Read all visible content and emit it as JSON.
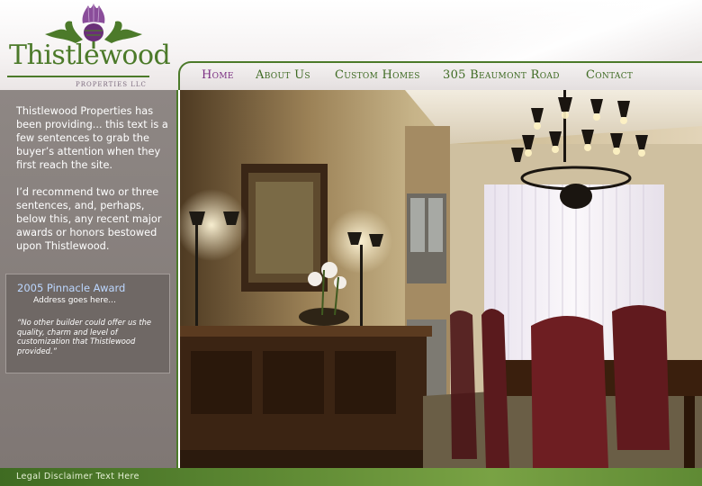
{
  "brand": {
    "name": "Thistlewood",
    "subtitle": "PROPERTIES LLC",
    "thistle_color": "#7a3c88",
    "leaf_color": "#4c7a2a"
  },
  "nav": {
    "items": [
      {
        "label": "Home",
        "active": true
      },
      {
        "label": "About Us",
        "active": false
      },
      {
        "label": "Custom Homes",
        "active": false
      },
      {
        "label": "305 Beaumont Road",
        "active": false
      },
      {
        "label": "Contact",
        "active": false
      }
    ],
    "active_color": "#7a2e82",
    "color": "#3d6a22"
  },
  "sidebar": {
    "intro_paragraphs": [
      "Thistlewood Properties has been providing... this text is a few sentences to grab the buyer’s attention when they first reach the site.",
      "I’d recommend two or three sentences, and, perhaps, below this, any recent major awards or honors bestowed upon Thistlewood."
    ],
    "award": {
      "title": "2005 Pinnacle Award",
      "address": "Address goes here...",
      "quote": "“No other builder could offer us the quality, charm and level of customization that Thistlewood provided.”"
    }
  },
  "hero": {
    "icon": "dining-room-photo"
  },
  "footer": {
    "legal": "Legal Disclaimer Text Here"
  }
}
